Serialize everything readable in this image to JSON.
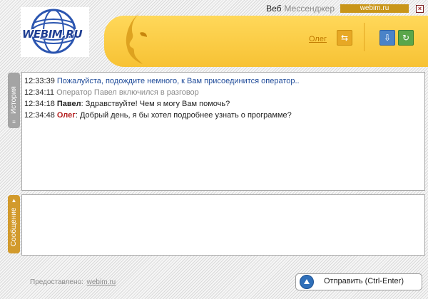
{
  "header": {
    "brand_web": "Веб",
    "brand_messenger": "Мессенджер",
    "site_badge": "webim.ru",
    "close_symbol": "×",
    "logo_text": "WEBIM.RU",
    "operator_name": "Олег"
  },
  "tabs": {
    "history": "История",
    "message": "Сообщение"
  },
  "messages": [
    {
      "time": "12:33:39",
      "text": "Пожалуйста, подождите немного, к Вам присоединится оператор.."
    },
    {
      "time": "12:34:11",
      "text": "Оператор Павел включился в разговор"
    },
    {
      "time": "12:34:18",
      "author": "Павел",
      "text": "Здравствуйте! Чем я могу Вам помочь?"
    },
    {
      "time": "12:34:48",
      "author": "Олег",
      "text": "Добрый день, я бы хотел подробнее узнать о программе?"
    }
  ],
  "message_input": {
    "value": ""
  },
  "footer": {
    "provided_by": "Предоставлено:",
    "provider_link": "webim.ru"
  },
  "send_button": {
    "label": "Отправить (Ctrl-Enter)"
  },
  "icons": [
    "globe-logo-icon",
    "face-silhouette-icon",
    "swap-arrows-icon",
    "save-history-icon",
    "refresh-icon",
    "close-icon",
    "arrow-up-icon"
  ],
  "colors": {
    "accent_yellow": "#f7c234",
    "badge_gold": "#c9961a",
    "operator_link": "#c07a00",
    "user_name": "#b52020",
    "info_blue": "#1f4b99"
  }
}
